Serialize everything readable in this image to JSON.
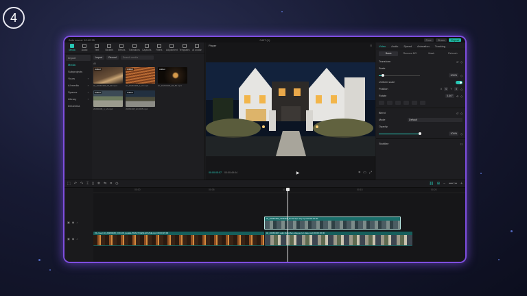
{
  "step_number": "4",
  "titlebar": {
    "left": "Auto saved: 10:42:35",
    "center": "0407 (1)",
    "buttons": [
      "Free",
      "Share",
      "Export"
    ]
  },
  "media_tools": [
    {
      "label": "Media",
      "icon": "media-icon",
      "active": true
    },
    {
      "label": "Audio",
      "icon": "audio-icon"
    },
    {
      "label": "Text",
      "icon": "text-icon"
    },
    {
      "label": "Stickers",
      "icon": "sticker-icon"
    },
    {
      "label": "Effects",
      "icon": "effects-icon"
    },
    {
      "label": "Transitions",
      "icon": "transition-icon"
    },
    {
      "label": "Captions",
      "icon": "captions-icon"
    },
    {
      "label": "Filters",
      "icon": "filter-icon"
    },
    {
      "label": "Adjustment",
      "icon": "adjust-icon"
    },
    {
      "label": "Templates",
      "icon": "template-icon"
    },
    {
      "label": "AI avatar",
      "icon": "avatar-icon"
    }
  ],
  "sidebar": [
    {
      "label": "Import",
      "boxed": true
    },
    {
      "label": "Media",
      "active": true
    },
    {
      "label": "Subprojects"
    },
    {
      "label": "Yours",
      "arrow": "›"
    },
    {
      "label": "AI media",
      "arrow": "›"
    },
    {
      "label": "Spaces",
      "arrow": "›"
    },
    {
      "label": "Library",
      "arrow": "›"
    },
    {
      "label": "Dreamina"
    }
  ],
  "media_header": {
    "import": "Import",
    "record": "Record",
    "search_placeholder": "Search media",
    "filter": "All"
  },
  "thumbnails": [
    {
      "tag": "Added",
      "name": "HI_20260408_06_80.mp4",
      "style": "t1"
    },
    {
      "tag": "Added",
      "name": "HI_20260408_0_33.mp4",
      "style": "t2"
    },
    {
      "tag": "Added",
      "name": "HI_20260408_08_80.mp4",
      "style": "t3"
    },
    {
      "tag": "Added",
      "name": "20260408_n_sh.mp4",
      "style": "t4"
    },
    {
      "tag": "Added",
      "name": "20260408_Hl.0005.mp4",
      "style": "t5"
    }
  ],
  "player": {
    "title": "Player",
    "timecode": "00:00:05:07",
    "total": "00:00:49:04"
  },
  "inspector": {
    "tabs": [
      "Video",
      "Audio",
      "Speed",
      "Animation",
      "Tracking"
    ],
    "active_tab": "Video",
    "subtabs": [
      "Basic",
      "Remove BG",
      "Mask",
      "Retouch"
    ],
    "active_subtab": "Basic",
    "transform": "Transform",
    "scale_label": "Scale",
    "scale_value": "100%",
    "scale_level": 0.1,
    "uniform_scale": "Uniform scale",
    "position_label": "Position",
    "position_x": "0",
    "position_y": "0",
    "rotate_label": "Rotate",
    "rotate_value": "0.00°",
    "blend_label": "Blend",
    "mode_label": "Mode",
    "mode_value": "Default",
    "opacity_label": "Opacity",
    "opacity_value": "100%",
    "opacity_level": 1,
    "stabilize_label": "Stabilize",
    "accent": "#27c6b4"
  },
  "ruler_marks": [
    "00:00",
    "00:05",
    "00:10",
    "00:15",
    "00:20"
  ],
  "clips": {
    "top_label": "HI_20260408_CINEMA_landscape-sky.mp4  00:00:10:00",
    "main_a_label": "V1 cover   HI_20260408_FOCUS_details-PRACT-NEW-HOUSE.mp4  00:00:15:00",
    "main_b_label": "HI_20260408_walk-Suburban-House-For-Sale.mp4  00:00:26:00"
  }
}
